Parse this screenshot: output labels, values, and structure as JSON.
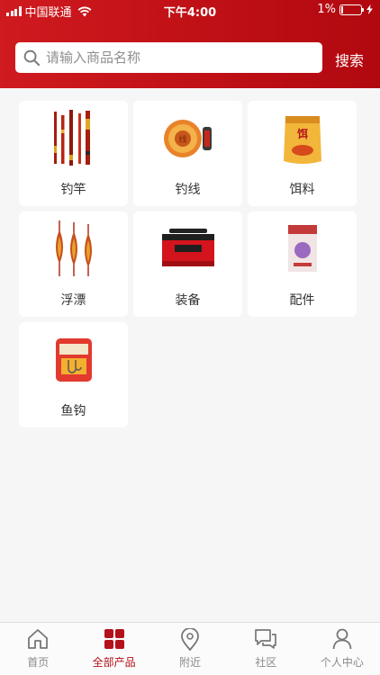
{
  "status_bar": {
    "carrier": "中国联通",
    "time": "下午4:00",
    "battery_pct": "1%"
  },
  "search": {
    "placeholder": "请输入商品名称",
    "button_label": "搜索"
  },
  "categories": [
    {
      "label": "钓竿",
      "icon": "fishing-rod-icon"
    },
    {
      "label": "钓线",
      "icon": "fishing-line-icon"
    },
    {
      "label": "饵料",
      "icon": "bait-bag-icon"
    },
    {
      "label": "浮漂",
      "icon": "float-icon"
    },
    {
      "label": "装备",
      "icon": "tackle-box-icon"
    },
    {
      "label": "配件",
      "icon": "accessory-pack-icon"
    },
    {
      "label": "鱼钩",
      "icon": "hook-pack-icon"
    }
  ],
  "tabbar": {
    "items": [
      {
        "label": "首页",
        "icon": "home-icon",
        "active": false
      },
      {
        "label": "全部产品",
        "icon": "grid-icon",
        "active": true
      },
      {
        "label": "附近",
        "icon": "location-pin-icon",
        "active": false
      },
      {
        "label": "社区",
        "icon": "chat-bubbles-icon",
        "active": false
      },
      {
        "label": "个人中心",
        "icon": "person-icon",
        "active": false
      }
    ]
  },
  "colors": {
    "brand_red": "#c4121a",
    "active_tab": "#b3121a",
    "inactive_tab": "#8a8a8a",
    "background": "#f6f6f6"
  }
}
